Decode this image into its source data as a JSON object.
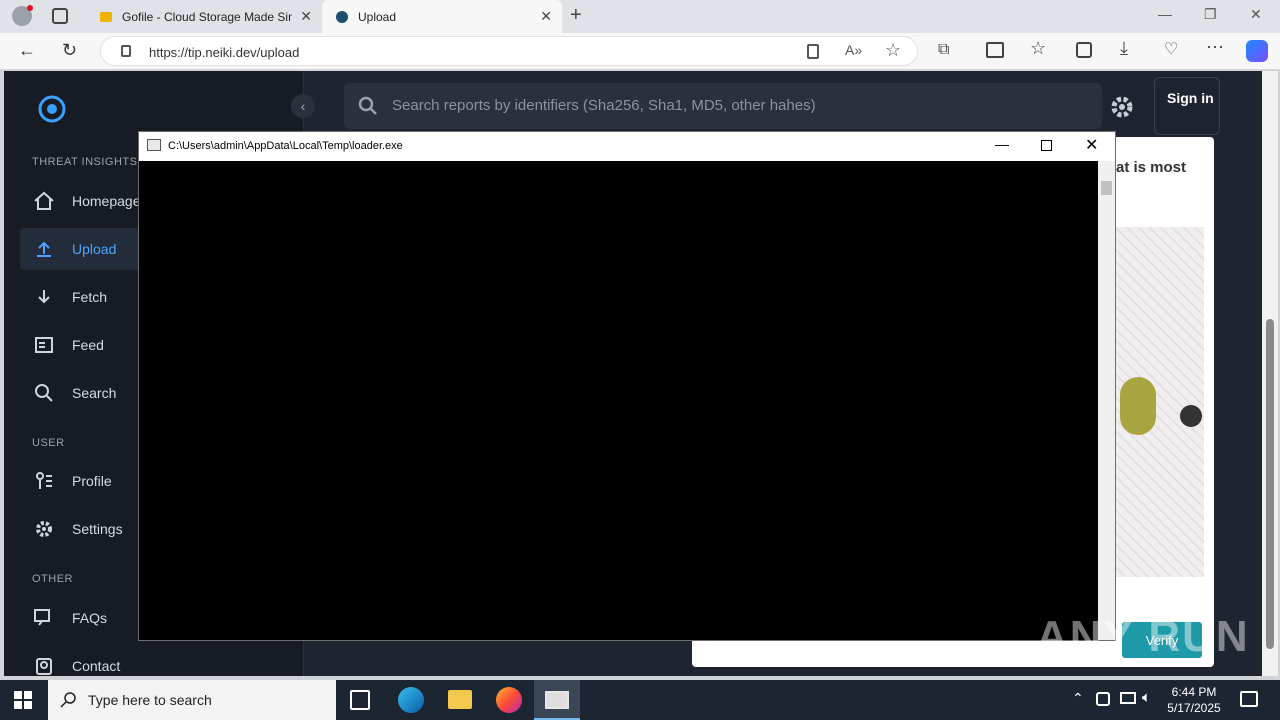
{
  "browser": {
    "tabs": [
      {
        "label": "Gofile - Cloud Storage Made Sim",
        "active": false
      },
      {
        "label": "Upload",
        "active": true
      }
    ],
    "url": "https://tip.neiki.dev/upload"
  },
  "page": {
    "sidebar": {
      "sections": {
        "threat": "THREAT INSIGHTS I",
        "user": "USER",
        "other": "OTHER"
      },
      "items": [
        {
          "label": "Homepage",
          "icon": "home-icon"
        },
        {
          "label": "Upload",
          "icon": "upload-icon",
          "active": true
        },
        {
          "label": "Fetch",
          "icon": "fetch-icon"
        },
        {
          "label": "Feed",
          "icon": "feed-icon"
        },
        {
          "label": "Search",
          "icon": "search-icon"
        },
        {
          "label": "Profile",
          "icon": "profile-icon"
        },
        {
          "label": "Settings",
          "icon": "gear-icon"
        },
        {
          "label": "FAQs",
          "icon": "faq-icon"
        },
        {
          "label": "Contact",
          "icon": "contact-icon"
        }
      ]
    },
    "search": {
      "placeholder": "Search reports by identifiers (Sha256, Sha1, MD5, other hahes)"
    },
    "signin": "Sign in",
    "captcha": {
      "prompt": "at is most",
      "verify": "Verify"
    }
  },
  "console": {
    "title": "C:\\Users\\admin\\AppData\\Local\\Temp\\loader.exe"
  },
  "taskbar": {
    "search_placeholder": "Type here to search",
    "time": "6:44 PM",
    "date": "5/17/2025"
  },
  "watermark": "ANY RUN",
  "colors": {
    "accent": "#4fa3ff",
    "sidebar": "#161b24",
    "page": "#1e2430"
  }
}
